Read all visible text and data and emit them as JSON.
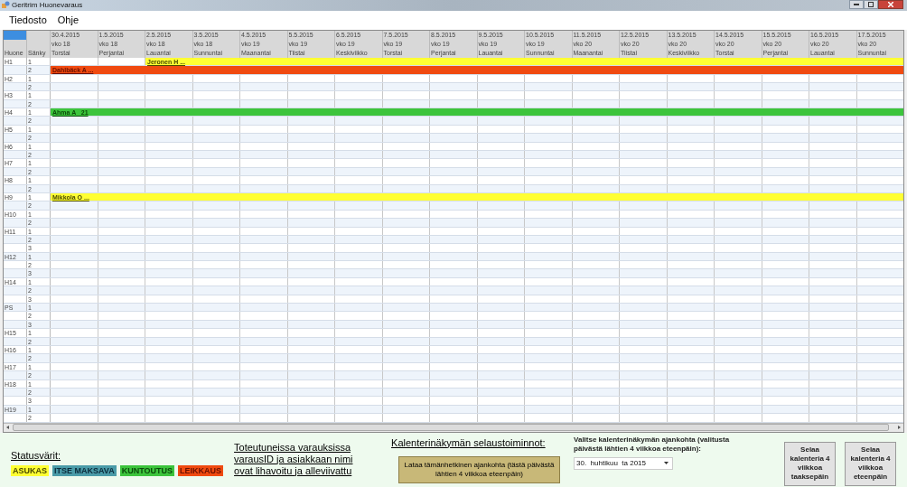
{
  "window": {
    "title": "Geritrim Huonevaraus"
  },
  "menu": [
    "Tiedosto",
    "Ohje"
  ],
  "grid": {
    "room_header": "Huone",
    "bed_header": "Sänky",
    "columns": [
      {
        "date": "30.4.2015",
        "week": "vko 18",
        "day": "Torstai"
      },
      {
        "date": "1.5.2015",
        "week": "vko 18",
        "day": "Perjantai"
      },
      {
        "date": "2.5.2015",
        "week": "vko 18",
        "day": "Lauantai"
      },
      {
        "date": "3.5.2015",
        "week": "vko 18",
        "day": "Sunnuntai"
      },
      {
        "date": "4.5.2015",
        "week": "vko 19",
        "day": "Maanantai"
      },
      {
        "date": "5.5.2015",
        "week": "vko 19",
        "day": "Tiistai"
      },
      {
        "date": "6.5.2015",
        "week": "vko 19",
        "day": "Keskiviikko"
      },
      {
        "date": "7.5.2015",
        "week": "vko 19",
        "day": "Torstai"
      },
      {
        "date": "8.5.2015",
        "week": "vko 19",
        "day": "Perjantai"
      },
      {
        "date": "9.5.2015",
        "week": "vko 19",
        "day": "Lauantai"
      },
      {
        "date": "10.5.2015",
        "week": "vko 19",
        "day": "Sunnuntai"
      },
      {
        "date": "11.5.2015",
        "week": "vko 20",
        "day": "Maanantai"
      },
      {
        "date": "12.5.2015",
        "week": "vko 20",
        "day": "Tiistai"
      },
      {
        "date": "13.5.2015",
        "week": "vko 20",
        "day": "Keskiviikko"
      },
      {
        "date": "14.5.2015",
        "week": "vko 20",
        "day": "Torstai"
      },
      {
        "date": "15.5.2015",
        "week": "vko 20",
        "day": "Perjantai"
      },
      {
        "date": "16.5.2015",
        "week": "vko 20",
        "day": "Lauantai"
      },
      {
        "date": "17.5.2015",
        "week": "vko 20",
        "day": "Sunnuntai"
      }
    ],
    "rooms": [
      {
        "name": "H1",
        "beds": [
          {
            "bed": "1",
            "booking": {
              "label": "Jeronen H ...",
              "kind": "asukas",
              "days": [
                {
                  "booked": false
                },
                {
                  "booked": false
                },
                {
                  "booked": true
                },
                {
                  "booked": true
                },
                {
                  "booked": true
                },
                {
                  "booked": true
                },
                {
                  "booked": true
                },
                {
                  "booked": true
                },
                {
                  "booked": true
                },
                {
                  "booked": true
                },
                {
                  "booked": true
                },
                {
                  "booked": true
                },
                {
                  "booked": true
                },
                {
                  "booked": true
                },
                {
                  "booked": true
                },
                {
                  "booked": true
                },
                {
                  "booked": true
                },
                {
                  "booked": true
                }
              ]
            }
          },
          {
            "bed": "2",
            "booking": {
              "label": "Dahlbäck A ...",
              "kind": "leikkaus",
              "days": [
                {
                  "booked": true
                },
                {
                  "booked": true
                },
                {
                  "booked": true
                },
                {
                  "booked": true
                },
                {
                  "booked": true
                },
                {
                  "booked": true
                },
                {
                  "booked": true
                },
                {
                  "booked": true
                },
                {
                  "booked": true
                },
                {
                  "booked": true
                },
                {
                  "booked": true
                },
                {
                  "booked": true
                },
                {
                  "booked": true
                },
                {
                  "booked": true
                },
                {
                  "booked": true
                },
                {
                  "booked": true
                },
                {
                  "booked": true
                },
                {
                  "booked": true
                }
              ]
            }
          }
        ]
      },
      {
        "name": "H2",
        "beds": [
          {
            "bed": "1"
          },
          {
            "bed": "2"
          }
        ]
      },
      {
        "name": "H3",
        "beds": [
          {
            "bed": "1"
          },
          {
            "bed": "2"
          }
        ]
      },
      {
        "name": "H4",
        "beds": [
          {
            "bed": "1",
            "booking": {
              "label": "Ahma A   21",
              "kind": "kuntoutus",
              "days": [
                {
                  "booked": true
                },
                {
                  "booked": true
                },
                {
                  "booked": true
                },
                {
                  "booked": true
                },
                {
                  "booked": true
                },
                {
                  "booked": true
                },
                {
                  "booked": true
                },
                {
                  "booked": true
                },
                {
                  "booked": true
                },
                {
                  "booked": true
                },
                {
                  "booked": true
                },
                {
                  "booked": true
                },
                {
                  "booked": true
                },
                {
                  "booked": true
                },
                {
                  "booked": true
                },
                {
                  "booked": true
                },
                {
                  "booked": true
                },
                {
                  "booked": true
                }
              ]
            }
          },
          {
            "bed": "2"
          }
        ]
      },
      {
        "name": "H5",
        "beds": [
          {
            "bed": "1"
          },
          {
            "bed": "2"
          }
        ]
      },
      {
        "name": "H6",
        "beds": [
          {
            "bed": "1"
          },
          {
            "bed": "2"
          }
        ]
      },
      {
        "name": "H7",
        "beds": [
          {
            "bed": "1"
          },
          {
            "bed": "2"
          }
        ]
      },
      {
        "name": "H8",
        "beds": [
          {
            "bed": "1"
          },
          {
            "bed": "2"
          }
        ]
      },
      {
        "name": "H9",
        "beds": [
          {
            "bed": "1",
            "booking": {
              "label": "Mikkola O ...",
              "kind": "asukas",
              "days": [
                {
                  "booked": true
                },
                {
                  "booked": true
                },
                {
                  "booked": true
                },
                {
                  "booked": true
                },
                {
                  "booked": true
                },
                {
                  "booked": true
                },
                {
                  "booked": true
                },
                {
                  "booked": true
                },
                {
                  "booked": true
                },
                {
                  "booked": true
                },
                {
                  "booked": true
                },
                {
                  "booked": true
                },
                {
                  "booked": true
                },
                {
                  "booked": true
                },
                {
                  "booked": true
                },
                {
                  "booked": true
                },
                {
                  "booked": true
                },
                {
                  "booked": true
                }
              ]
            }
          },
          {
            "bed": "2"
          }
        ]
      },
      {
        "name": "H10",
        "beds": [
          {
            "bed": "1"
          },
          {
            "bed": "2"
          }
        ]
      },
      {
        "name": "H11",
        "beds": [
          {
            "bed": "1"
          },
          {
            "bed": "2"
          },
          {
            "bed": "3"
          }
        ]
      },
      {
        "name": "H12",
        "beds": [
          {
            "bed": "1"
          },
          {
            "bed": "2"
          },
          {
            "bed": "3"
          }
        ]
      },
      {
        "name": "H14",
        "beds": [
          {
            "bed": "1"
          },
          {
            "bed": "2"
          },
          {
            "bed": "3"
          }
        ]
      },
      {
        "name": "PS",
        "beds": [
          {
            "bed": "1"
          },
          {
            "bed": "2"
          },
          {
            "bed": "3"
          }
        ]
      },
      {
        "name": "H15",
        "beds": [
          {
            "bed": "1"
          },
          {
            "bed": "2"
          }
        ]
      },
      {
        "name": "H16",
        "beds": [
          {
            "bed": "1"
          },
          {
            "bed": "2"
          }
        ]
      },
      {
        "name": "H17",
        "beds": [
          {
            "bed": "1"
          },
          {
            "bed": "2"
          }
        ]
      },
      {
        "name": "H18",
        "beds": [
          {
            "bed": "1"
          },
          {
            "bed": "2"
          },
          {
            "bed": "3"
          }
        ]
      },
      {
        "name": "H19",
        "beds": [
          {
            "bed": "1"
          },
          {
            "bed": "2"
          }
        ]
      }
    ]
  },
  "legend": {
    "title": "Statusvärit:",
    "items": [
      {
        "kind": "asukas",
        "label": "ASUKAS",
        "color": "#ffff33"
      },
      {
        "kind": "itse",
        "label": "ITSE MAKSAVA",
        "color": "#4a9ba8"
      },
      {
        "kind": "kuntoutus",
        "label": "KUNTOUTUS",
        "color": "#3cc43c"
      },
      {
        "kind": "leikkaus",
        "label": "LEIKKAUS",
        "color": "#f04a10"
      }
    ]
  },
  "note": "Toteutuneissa varauksissa varausID ja asiakkaan nimi ovat lihavoitu ja alleviivattu",
  "browse": {
    "title": "Kalenterinäkymän selaustoiminnot:",
    "current_button": "Lataa tämänhetkinen ajankohta (tästä päivästä lähtien 4 viikkoa eteenpäin)",
    "picker_label": "Valitse kalenterinäkymän ajankohta (valitusta päivästä lähtien 4 viikkoa eteenpäin):",
    "picker_value": "30.  huhtikuu  ta 2015",
    "back_button": "Selaa kalenteria 4 viikkoa taaksepäin",
    "forward_button": "Selaa kalenteria 4 viikkoa eteenpäin"
  }
}
